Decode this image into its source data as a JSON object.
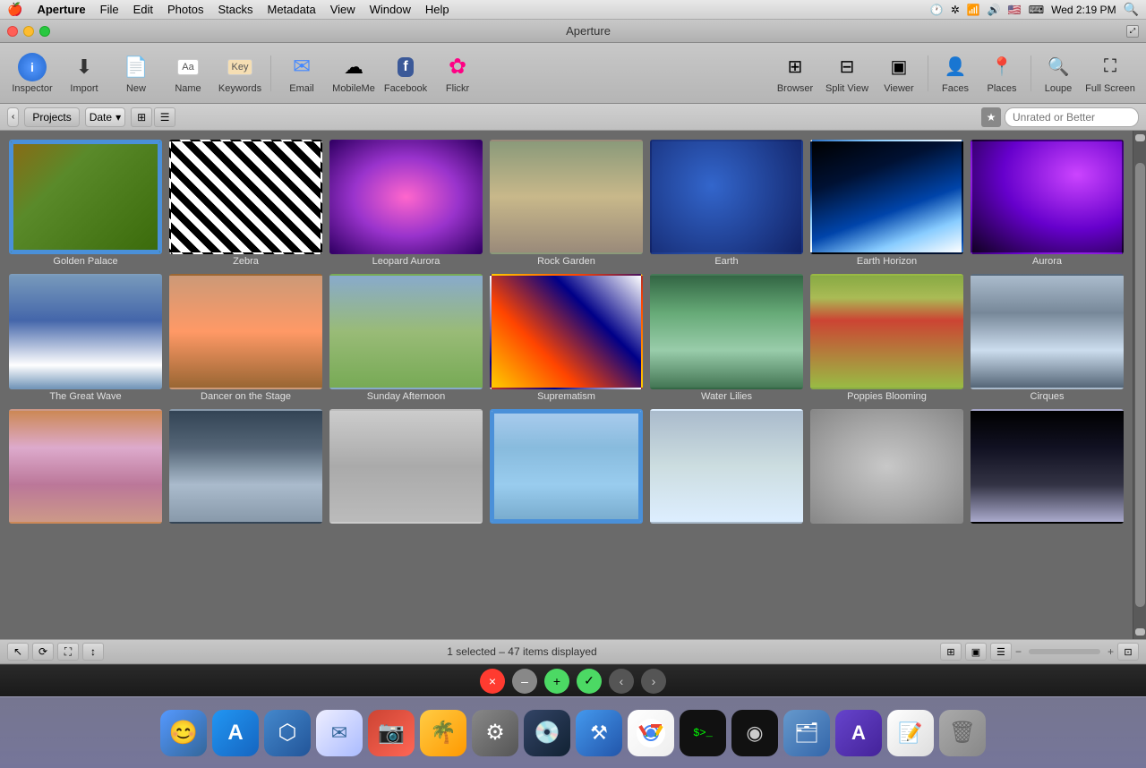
{
  "menubar": {
    "apple": "🍎",
    "items": [
      "Aperture",
      "File",
      "Edit",
      "Photos",
      "Stacks",
      "Metadata",
      "View",
      "Window",
      "Help"
    ],
    "time": "Wed 2:19 PM",
    "right_icons": [
      "🕐",
      "📶",
      "🔊",
      "🇺🇸"
    ]
  },
  "window": {
    "title": "Aperture",
    "traffic_lights": {
      "close": "×",
      "minimize": "–",
      "maximize": "+"
    }
  },
  "toolbar": {
    "buttons": [
      {
        "id": "inspector",
        "label": "Inspector",
        "icon": "i"
      },
      {
        "id": "import",
        "label": "Import",
        "icon": "⬇"
      },
      {
        "id": "new",
        "label": "New",
        "icon": "📄"
      },
      {
        "id": "name",
        "label": "Name",
        "icon": "N"
      },
      {
        "id": "keywords",
        "label": "Keywords",
        "icon": "K"
      },
      {
        "id": "email",
        "label": "Email",
        "icon": "✉"
      },
      {
        "id": "mobileme",
        "label": "MobileMe",
        "icon": "☁"
      },
      {
        "id": "facebook",
        "label": "Facebook",
        "icon": "f"
      },
      {
        "id": "flickr",
        "label": "Flickr",
        "icon": "✿"
      }
    ],
    "right_buttons": [
      {
        "id": "browser",
        "label": "Browser",
        "icon": "⊞"
      },
      {
        "id": "split-view",
        "label": "Split View",
        "icon": "⊟"
      },
      {
        "id": "viewer",
        "label": "Viewer",
        "icon": "▣"
      },
      {
        "id": "faces",
        "label": "Faces",
        "icon": "👤"
      },
      {
        "id": "places",
        "label": "Places",
        "icon": "📍"
      },
      {
        "id": "loupe",
        "label": "Loupe",
        "icon": "🔍"
      },
      {
        "id": "full-screen",
        "label": "Full Screen",
        "icon": "⛶"
      }
    ]
  },
  "navbar": {
    "back_arrow": "‹",
    "projects_label": "Projects",
    "date_label": "Date",
    "grid_icon": "⊞",
    "list_icon": "☰",
    "search_placeholder": "Unrated or Better"
  },
  "photos": [
    {
      "id": "golden-palace",
      "label": "Golden Palace",
      "selected": true,
      "color_class": "photo-golden-palace"
    },
    {
      "id": "zebra",
      "label": "Zebra",
      "selected": false,
      "color_class": "photo-zebra"
    },
    {
      "id": "leopard-aurora",
      "label": "Leopard Aurora",
      "selected": false,
      "color_class": "photo-leopard-aurora"
    },
    {
      "id": "rock-garden",
      "label": "Rock Garden",
      "selected": false,
      "color_class": "photo-rock-garden"
    },
    {
      "id": "earth",
      "label": "Earth",
      "selected": false,
      "color_class": "photo-earth"
    },
    {
      "id": "earth-horizon",
      "label": "Earth Horizon",
      "selected": false,
      "color_class": "photo-earth-horizon"
    },
    {
      "id": "aurora",
      "label": "Aurora",
      "selected": false,
      "color_class": "photo-aurora"
    },
    {
      "id": "great-wave",
      "label": "The Great Wave",
      "selected": false,
      "color_class": "photo-great-wave"
    },
    {
      "id": "dancer",
      "label": "Dancer on the Stage",
      "selected": false,
      "color_class": "photo-dancer"
    },
    {
      "id": "sunday-afternoon",
      "label": "Sunday Afternoon",
      "selected": false,
      "color_class": "photo-sunday"
    },
    {
      "id": "suprematism",
      "label": "Suprematism",
      "selected": false,
      "color_class": "photo-suprematism"
    },
    {
      "id": "water-lilies",
      "label": "Water Lilies",
      "selected": false,
      "color_class": "photo-water-lilies"
    },
    {
      "id": "poppies-blooming",
      "label": "Poppies Blooming",
      "selected": false,
      "color_class": "photo-poppies"
    },
    {
      "id": "cirques",
      "label": "Cirques",
      "selected": false,
      "color_class": "photo-cirques"
    },
    {
      "id": "mountain",
      "label": "",
      "selected": false,
      "color_class": "photo-mountain"
    },
    {
      "id": "pebbles-sea",
      "label": "",
      "selected": false,
      "color_class": "photo-pebbles-sea"
    },
    {
      "id": "sketch",
      "label": "",
      "selected": false,
      "color_class": "photo-sketch"
    },
    {
      "id": "glacier",
      "label": "",
      "selected": true,
      "color_class": "photo-glacier"
    },
    {
      "id": "mist",
      "label": "",
      "selected": false,
      "color_class": "photo-mist"
    },
    {
      "id": "stones",
      "label": "",
      "selected": false,
      "color_class": "photo-stones"
    },
    {
      "id": "snow-mountain",
      "label": "",
      "selected": false,
      "color_class": "photo-snow-mtn"
    }
  ],
  "statusbar": {
    "text": "1 selected – 47 items displayed",
    "tools": [
      "↖",
      "✋",
      "📷",
      "📷"
    ]
  },
  "controls": {
    "close": "×",
    "minus": "–",
    "plus_green": "+",
    "check": "✓",
    "back": "‹",
    "forward": "›"
  },
  "dock": {
    "icons": [
      {
        "id": "finder",
        "label": "Finder",
        "symbol": "😊",
        "color_class": "dock-finder"
      },
      {
        "id": "appstore",
        "label": "App Store",
        "symbol": "A",
        "color_class": "dock-appstore"
      },
      {
        "id": "migration",
        "label": "Migration",
        "symbol": "⬡",
        "color_class": "dock-migration"
      },
      {
        "id": "mail",
        "label": "Mail",
        "symbol": "✉",
        "color_class": "dock-mail"
      },
      {
        "id": "photo-booth",
        "label": "Photo Booth",
        "symbol": "📷",
        "color_class": "dock-photo-booth"
      },
      {
        "id": "iphoto",
        "label": "iPhoto",
        "symbol": "🌴",
        "color_class": "dock-iphoto"
      },
      {
        "id": "automator",
        "label": "Automator",
        "symbol": "⚙",
        "color_class": "dock-automator"
      },
      {
        "id": "dvd",
        "label": "DVD Player",
        "symbol": "💿",
        "color_class": "dock-dvd"
      },
      {
        "id": "xcode",
        "label": "Xcode",
        "symbol": "⚒",
        "color_class": "dock-xcode"
      },
      {
        "id": "chrome",
        "label": "Chrome",
        "symbol": "◎",
        "color_class": "dock-chrome"
      },
      {
        "id": "terminal",
        "label": "Terminal",
        "symbol": ">_",
        "color_class": "dock-terminal"
      },
      {
        "id": "camera",
        "label": "Camera",
        "symbol": "◉",
        "color_class": "dock-camera"
      },
      {
        "id": "finder2",
        "label": "Finder",
        "symbol": "🗂",
        "color_class": "dock-finder2"
      },
      {
        "id": "ios-sim",
        "label": "iOS Simulator",
        "symbol": "A",
        "color_class": "dock-ios"
      },
      {
        "id": "text-edit",
        "label": "TextEdit",
        "symbol": "📝",
        "color_class": "dock-txt"
      },
      {
        "id": "trash",
        "label": "Trash",
        "symbol": "🗑",
        "color_class": "dock-trash"
      }
    ]
  }
}
